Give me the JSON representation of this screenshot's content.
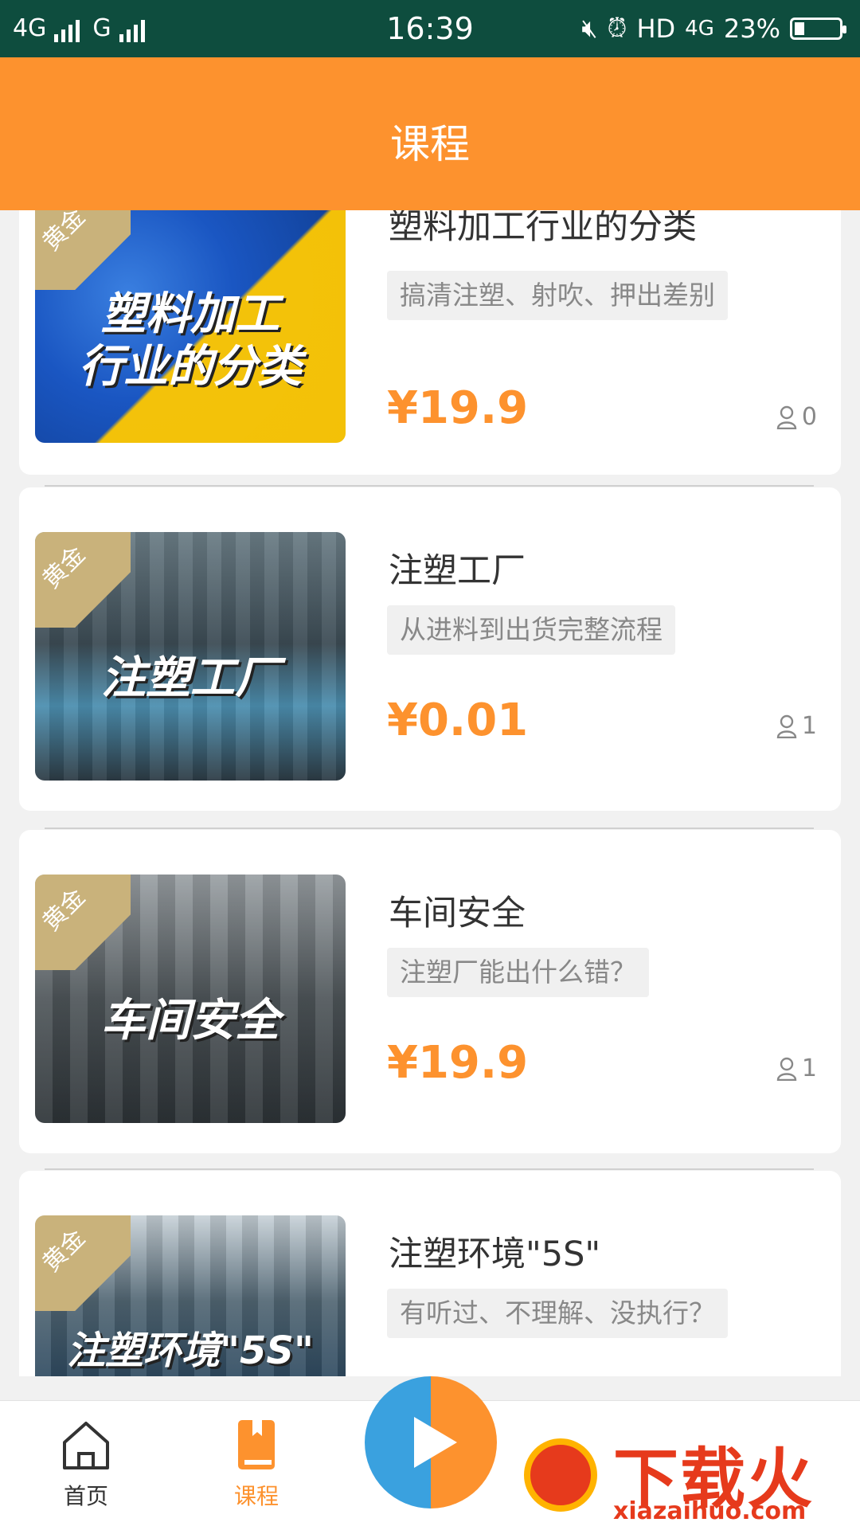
{
  "status_bar": {
    "left_text_1": "4G",
    "left_text_2": "G",
    "time": "16:39",
    "hd": "HD",
    "net": "4G",
    "battery_pct": "23%",
    "battery_level": 0.23
  },
  "header": {
    "title": "课程"
  },
  "courses": [
    {
      "badge": "黄金",
      "image_caption": "塑料加工\n行业的分类",
      "title": "塑料加工行业的分类",
      "tag": "搞清注塑、射吹、押出差别",
      "price": "¥19.9",
      "count": "0"
    },
    {
      "badge": "黄金",
      "image_caption": "注塑工厂",
      "title": "注塑工厂",
      "tag": "从进料到出货完整流程",
      "price": "¥0.01",
      "count": "1"
    },
    {
      "badge": "黄金",
      "image_caption": "车间安全",
      "title": "车间安全",
      "tag": "注塑厂能出什么错？",
      "price": "¥19.9",
      "count": "1"
    },
    {
      "badge": "黄金",
      "image_caption": "注塑环境\"5S\"",
      "title": "注塑环境\"5S\"",
      "tag": "有听过、不理解、没执行？",
      "price": "",
      "count": ""
    }
  ],
  "tabbar": {
    "home_label": "首页",
    "course_label": "课程",
    "accent": "#fd922e"
  },
  "watermark": {
    "text": "下载火",
    "url": "xiazaihuo.com"
  }
}
